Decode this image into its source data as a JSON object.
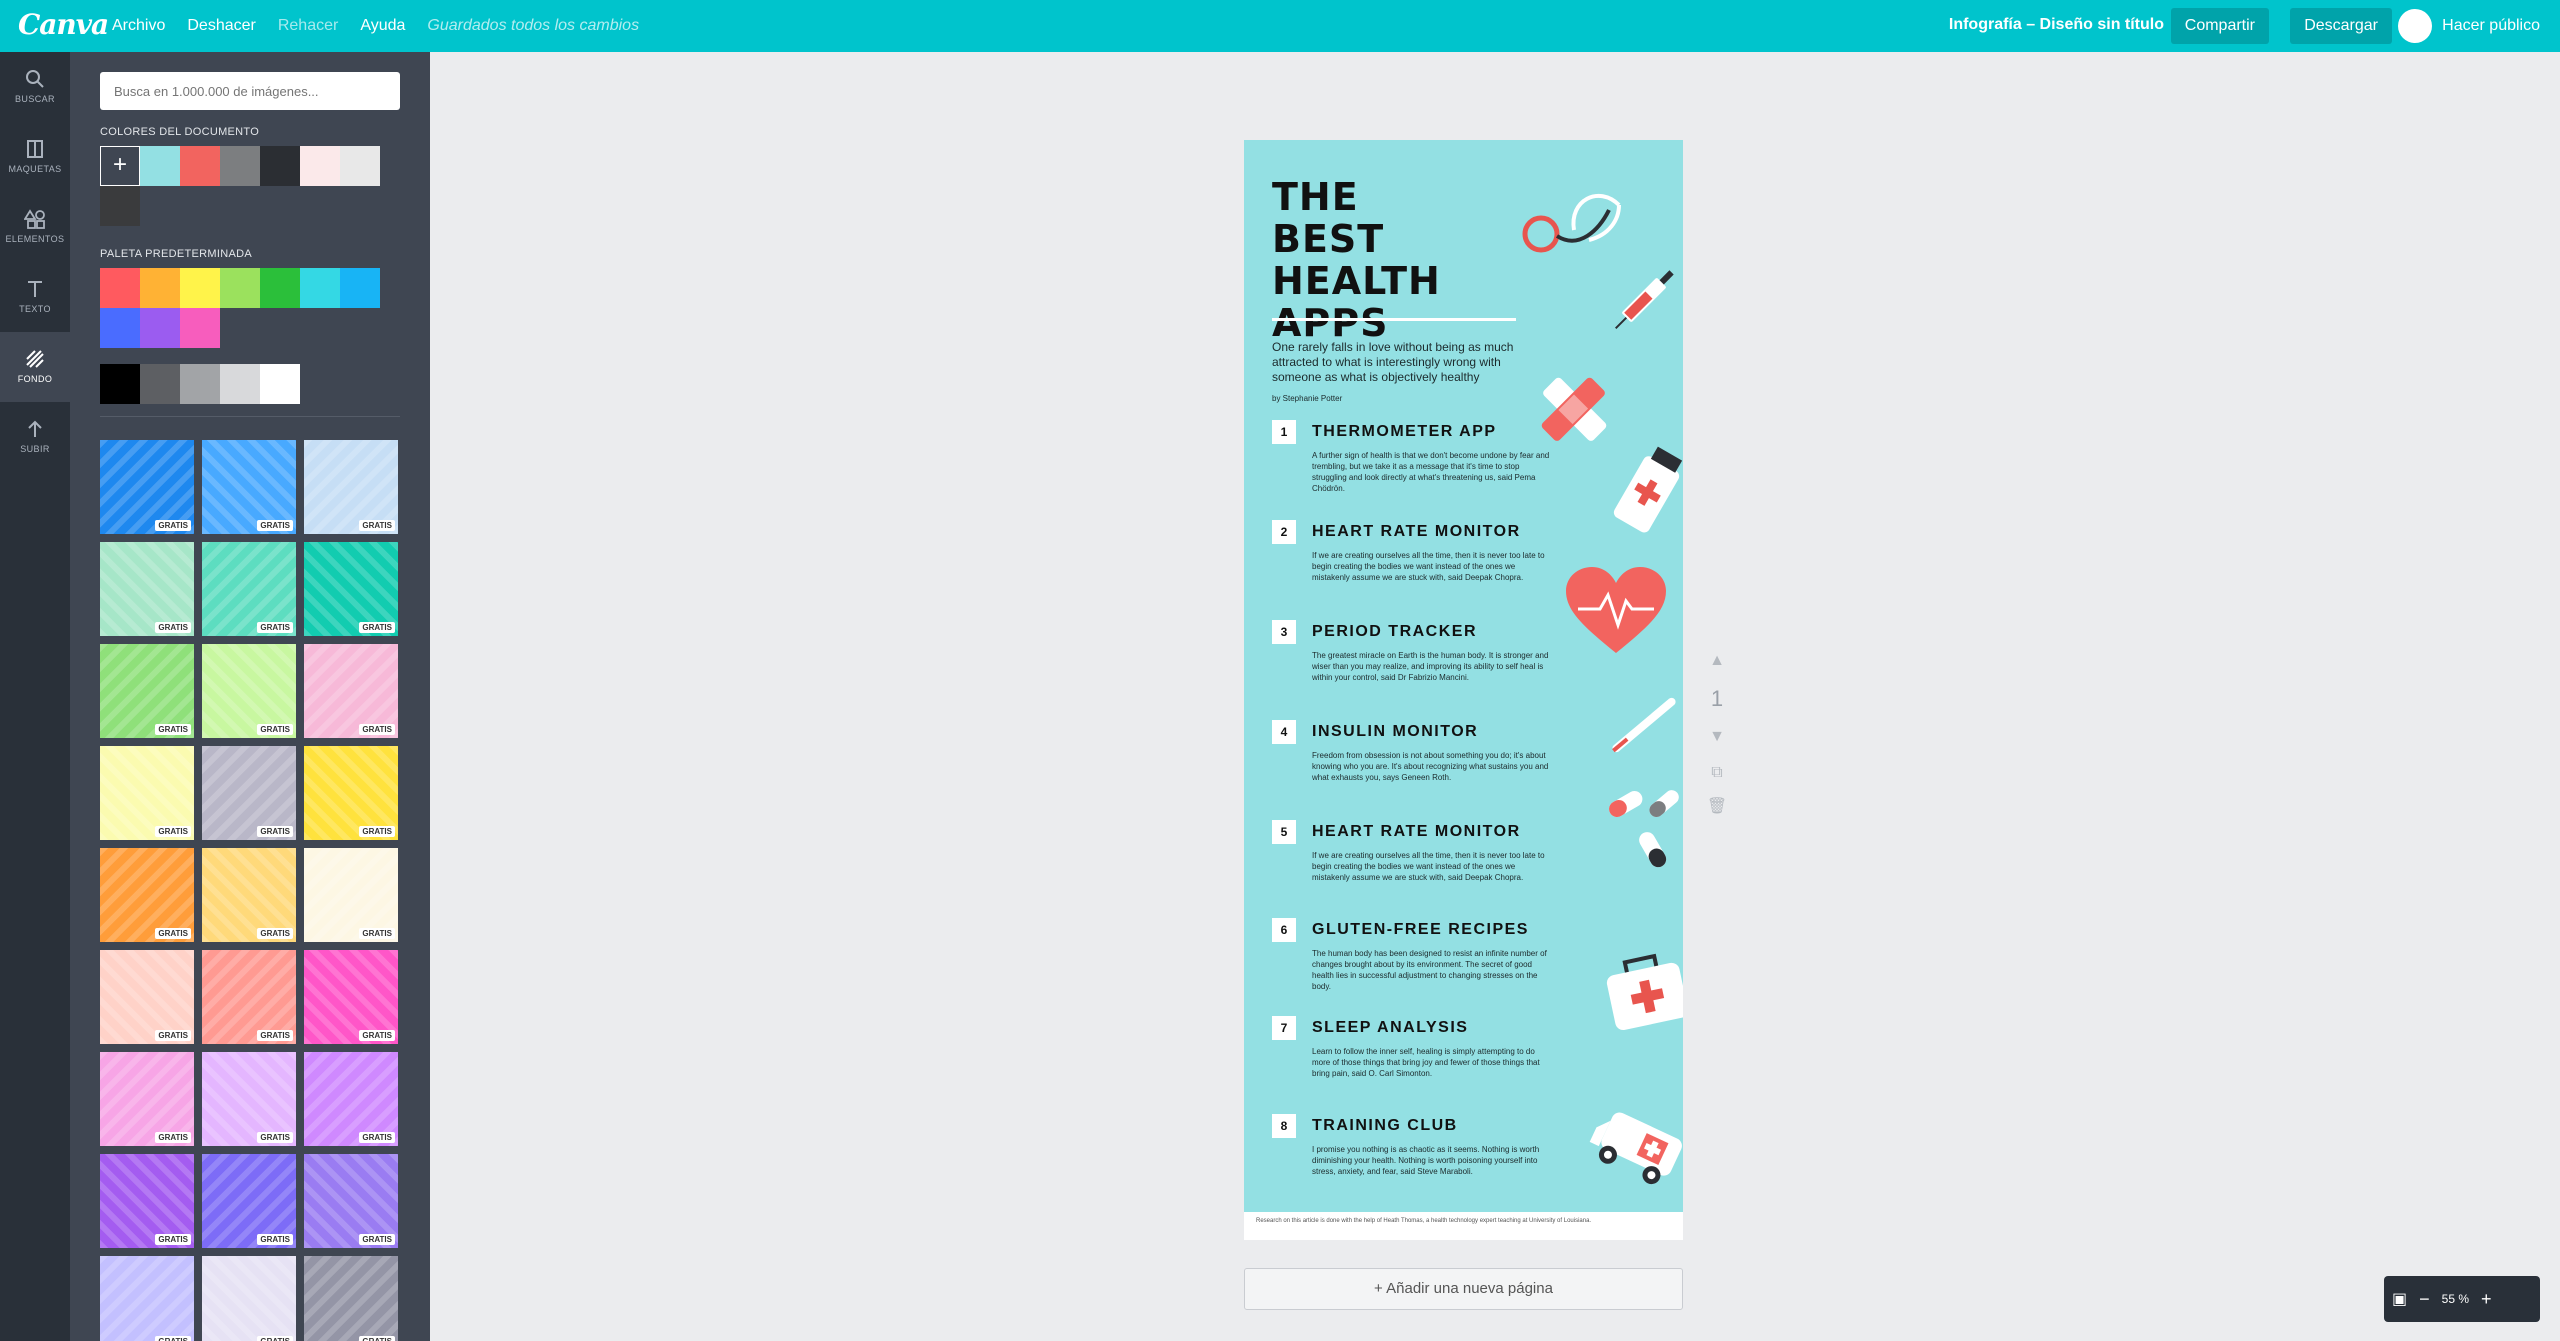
{
  "topbar": {
    "logo": "Canva",
    "menu": [
      "Archivo",
      "Deshacer",
      "Rehacer",
      "Ayuda"
    ],
    "status": "Guardados todos los cambios",
    "doc_title": "Infografía – Diseño sin título",
    "share": "Compartir",
    "download": "Descargar",
    "publish": "Hacer público"
  },
  "rail": [
    {
      "label": "BUSCAR",
      "icon": "search-icon"
    },
    {
      "label": "MAQUETAS",
      "icon": "layouts-icon"
    },
    {
      "label": "ELEMENTOS",
      "icon": "elements-icon"
    },
    {
      "label": "TEXTO",
      "icon": "text-icon"
    },
    {
      "label": "FONDO",
      "icon": "background-icon"
    },
    {
      "label": "SUBIR",
      "icon": "upload-icon"
    }
  ],
  "panel": {
    "search_placeholder": "Busca en 1.000.000 de imágenes...",
    "doc_colors_title": "COLORES DEL DOCUMENTO",
    "doc_colors": [
      "#93e0e3",
      "#f2645f",
      "#7c7e80",
      "#2b2e33",
      "#fbe9ea",
      "#e8e8e8",
      "#3a3b3d"
    ],
    "default_palette_title": "PALETA PREDETERMINADA",
    "default_palette": [
      "#ff5a5f",
      "#ffb234",
      "#fff34a",
      "#9be15d",
      "#2bbf3a",
      "#34d8e4",
      "#18b4f5",
      "#4a6cff",
      "#9b5cf0",
      "#f75dbd"
    ],
    "grays": [
      "#000000",
      "#5d5f63",
      "#a2a4a7",
      "#d8d9db",
      "#ffffff"
    ],
    "badge": "GRATIS",
    "backgrounds": [
      "#1e88ef",
      "#48a9ff",
      "#c6def5",
      "#a6e6c8",
      "#5dddc0",
      "#12ccb0",
      "#8fe07a",
      "#c8f7a0",
      "#f7b9d8",
      "#fbfbb0",
      "#b9b7c8",
      "#ffe23d",
      "#ff9d3a",
      "#ffd97a",
      "#fdf7e4",
      "#ffd2c8",
      "#ff9a92",
      "#ff56c8",
      "#f7a5e6",
      "#e4b6ff",
      "#cf89ff",
      "#a45cf0",
      "#7d6cf7",
      "#9a7cf2",
      "#c3c0ff",
      "#e6e2f4",
      "#9495a6"
    ]
  },
  "page": {
    "title": "THE BEST HEALTH APPS",
    "intro": "One rarely falls in love without being as much attracted to what is interestingly wrong with someone as what is objectively healthy",
    "byline": "by Stephanie Potter",
    "items": [
      {
        "n": "1",
        "title": "THERMOMETER APP",
        "body": "A further sign of health is that we don't become undone by fear and trembling, but we take it as a message that it's time to stop struggling and look directly at what's threatening us, said Pema Chödrön."
      },
      {
        "n": "2",
        "title": "HEART RATE MONITOR",
        "body": "If we are creating ourselves all the time, then it is never too late to begin creating the bodies we want instead of the ones we mistakenly assume we are stuck with, said Deepak Chopra."
      },
      {
        "n": "3",
        "title": "PERIOD TRACKER",
        "body": "The greatest miracle on Earth is the human body. It is stronger and wiser than you may realize, and improving its ability to self heal is within your control, said Dr Fabrizio Mancini."
      },
      {
        "n": "4",
        "title": "INSULIN MONITOR",
        "body": "Freedom from obsession is not about something you do; it's about knowing who you are. It's about recognizing what sustains you and what exhausts you, says Geneen Roth."
      },
      {
        "n": "5",
        "title": "HEART RATE MONITOR",
        "body": "If we are creating ourselves all the time, then it is never too late to begin creating the bodies we want instead of the ones we mistakenly assume we are stuck with, said Deepak Chopra."
      },
      {
        "n": "6",
        "title": "GLUTEN-FREE RECIPES",
        "body": "The human body has been designed to resist an infinite number of changes brought about by its environment. The secret of good health lies in successful adjustment to changing stresses on the body."
      },
      {
        "n": "7",
        "title": "SLEEP ANALYSIS",
        "body": "Learn to follow the inner self, healing is simply attempting to do more of those things that bring joy and fewer of those things that bring pain, said O. Carl Simonton."
      },
      {
        "n": "8",
        "title": "TRAINING CLUB",
        "body": "I promise you nothing is as chaotic as it seems. Nothing is worth diminishing your health. Nothing is worth poisoning yourself into stress, anxiety, and fear, said Steve Maraboli."
      }
    ],
    "footer": "Research on this article is done with the help of Heath Thomas, a health technology expert teaching at University of Louisiana."
  },
  "side_tools": {
    "page_number": "1"
  },
  "add_page": "+ Añadir una nueva página",
  "zoom": {
    "value": "55 %",
    "minus": "−",
    "plus": "+"
  }
}
